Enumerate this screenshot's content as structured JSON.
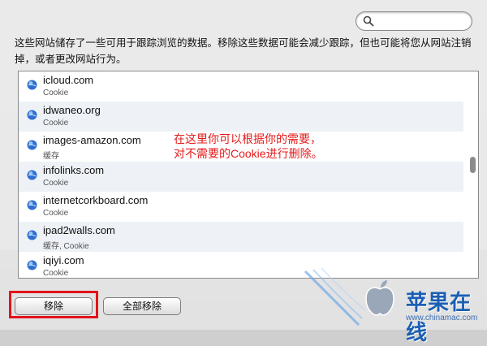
{
  "search": {
    "placeholder": "",
    "value": ""
  },
  "description": "这些网站储存了一些可用于跟踪浏览的数据。移除这些数据可能会减少跟踪，但也可能将您从网站注销掉，或者更改网站行为。",
  "sites": [
    {
      "name": "icloud.com",
      "kind": "Cookie"
    },
    {
      "name": "idwaneo.org",
      "kind": "Cookie"
    },
    {
      "name": "images-amazon.com",
      "kind": "缓存"
    },
    {
      "name": "infolinks.com",
      "kind": "Cookie"
    },
    {
      "name": "internetcorkboard.com",
      "kind": "Cookie"
    },
    {
      "name": "ipad2walls.com",
      "kind": "缓存, Cookie"
    },
    {
      "name": "iqiyi.com",
      "kind": "Cookie"
    }
  ],
  "annotation": {
    "line1": "在这里你可以根据你的需要，",
    "line2": "对不需要的Cookie进行删除。"
  },
  "buttons": {
    "remove": "移除",
    "remove_all": "全部移除"
  },
  "watermark": {
    "text": "苹果在线",
    "url": "www.chinamac.com"
  },
  "colors": {
    "annotation": "#e51b1b",
    "highlight_box": "#e2131a",
    "alt_row": "#eef1f6"
  }
}
